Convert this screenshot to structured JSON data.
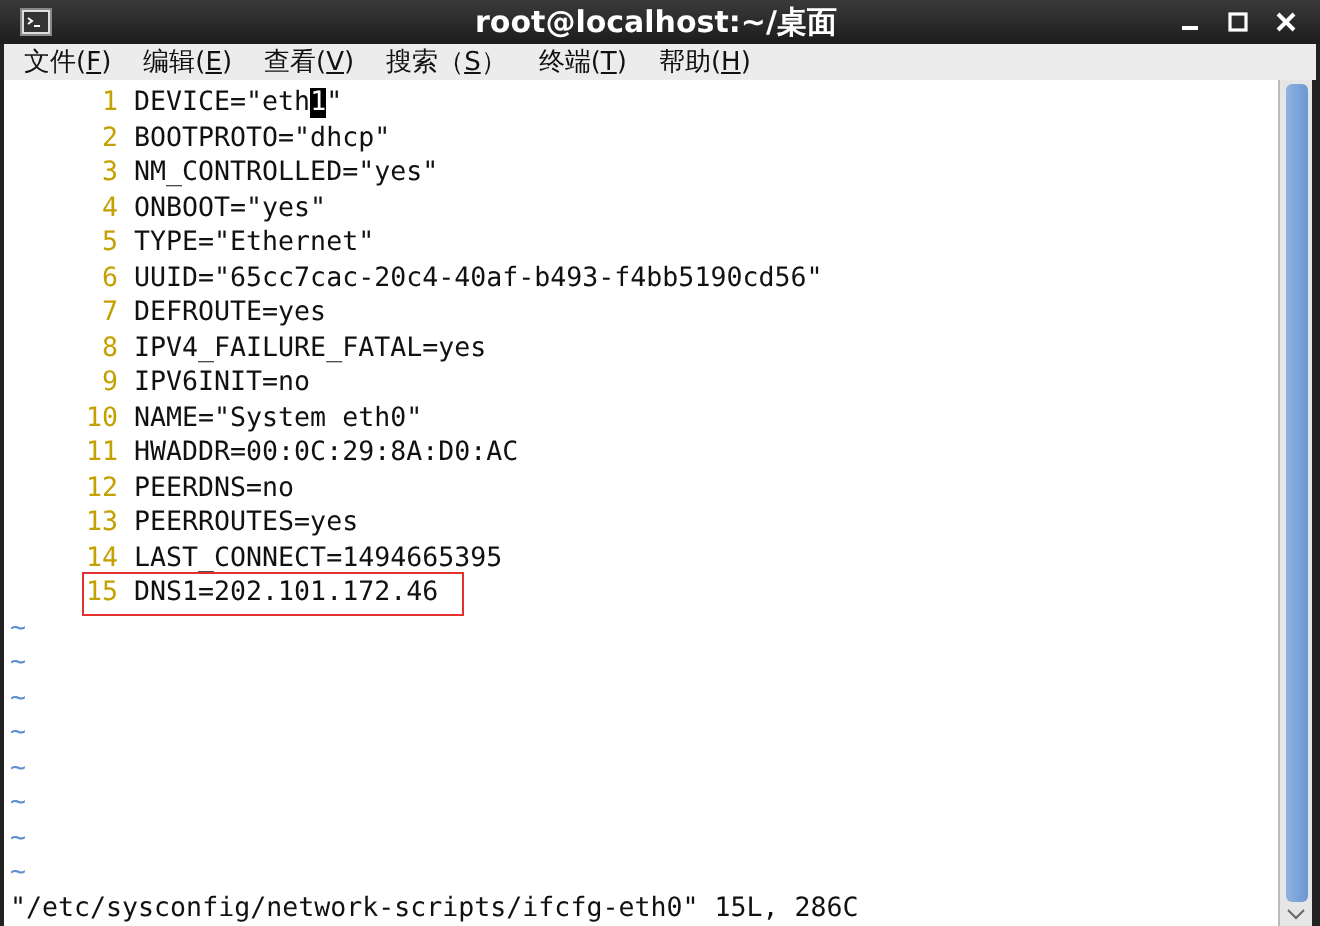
{
  "window": {
    "title": "root@localhost:~/桌面"
  },
  "menu": [
    {
      "label": "文件(",
      "key": "F",
      "end": ")"
    },
    {
      "label": "编辑(",
      "key": "E",
      "end": ")"
    },
    {
      "label": "查看(",
      "key": "V",
      "end": ")"
    },
    {
      "label": "搜索（",
      "key": "S",
      "end": "）"
    },
    {
      "label": "终端(",
      "key": "T",
      "end": ")"
    },
    {
      "label": "帮助(",
      "key": "H",
      "end": ")"
    }
  ],
  "lines": [
    {
      "number": "1",
      "text": "DEVICE=\"eth",
      "cursor_char": "1",
      "text_after": "\"",
      "highlighted": false
    },
    {
      "number": "2",
      "text": "BOOTPROTO=\"dhcp\"",
      "highlighted": false
    },
    {
      "number": "3",
      "text": "NM_CONTROLLED=\"yes\"",
      "highlighted": false
    },
    {
      "number": "4",
      "text": "ONBOOT=\"yes\"",
      "highlighted": false
    },
    {
      "number": "5",
      "text": "TYPE=\"Ethernet\"",
      "highlighted": false
    },
    {
      "number": "6",
      "text": "UUID=\"65cc7cac-20c4-40af-b493-f4bb5190cd56\"",
      "highlighted": false
    },
    {
      "number": "7",
      "text": "DEFROUTE=yes",
      "highlighted": false
    },
    {
      "number": "8",
      "text": "IPV4_FAILURE_FATAL=yes",
      "highlighted": false
    },
    {
      "number": "9",
      "text": "IPV6INIT=no",
      "highlighted": false
    },
    {
      "number": "10",
      "text": "NAME=\"System eth0\"",
      "highlighted": false
    },
    {
      "number": "11",
      "text": "HWADDR=00:0C:29:8A:D0:AC",
      "highlighted": false
    },
    {
      "number": "12",
      "text": "PEERDNS=no",
      "highlighted": false
    },
    {
      "number": "13",
      "text": "PEERROUTES=yes",
      "highlighted": false
    },
    {
      "number": "14",
      "text": "LAST_CONNECT=1494665395",
      "highlighted": false
    },
    {
      "number": "15",
      "text": "DNS1=202.101.172.46",
      "highlighted": true
    }
  ],
  "empty_lines": [
    "~",
    "~",
    "~",
    "~",
    "~",
    "~",
    "~",
    "~"
  ],
  "status_line": "\"/etc/sysconfig/network-scripts/ifcfg-eth0\" 15L, 286C"
}
